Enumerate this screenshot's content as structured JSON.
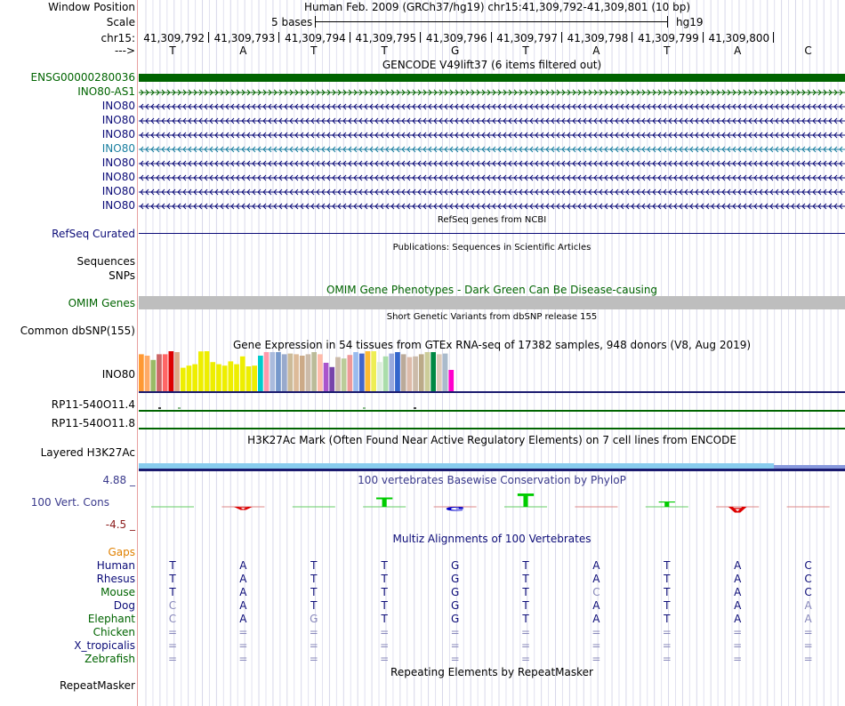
{
  "header": {
    "window_position_label": "Window Position",
    "window_position_text": "Human Feb. 2009 (GRCh37/hg19)   chr15:41,309,792-41,309,801 (10 bp)",
    "scale_label": "Scale",
    "scale_text": "5 bases",
    "assembly": "hg19",
    "chrom_label": "chr15:",
    "strand_label": "--->",
    "positions": [
      "41,309,792",
      "41,309,793",
      "41,309,794",
      "41,309,795",
      "41,309,796",
      "41,309,797",
      "41,309,798",
      "41,309,799",
      "41,309,800"
    ],
    "sequence": [
      "T",
      "A",
      "T",
      "T",
      "G",
      "T",
      "A",
      "T",
      "A",
      "C"
    ]
  },
  "gencode": {
    "title": "GENCODE V49lift37 (6 items filtered out)",
    "rows": [
      {
        "label": "ENSG00000280036",
        "color": "#006400",
        "type": "bar"
      },
      {
        "label": "INO80-AS1",
        "color": "#006400",
        "type": "plus"
      },
      {
        "label": "INO80",
        "color": "#0c0c78",
        "type": "minus"
      },
      {
        "label": "INO80",
        "color": "#0c0c78",
        "type": "minus"
      },
      {
        "label": "INO80",
        "color": "#0c0c78",
        "type": "minus"
      },
      {
        "label": "INO80",
        "color": "#1a7fa0",
        "type": "minus"
      },
      {
        "label": "INO80",
        "color": "#0c0c78",
        "type": "minus"
      },
      {
        "label": "INO80",
        "color": "#0c0c78",
        "type": "minus"
      },
      {
        "label": "INO80",
        "color": "#0c0c78",
        "type": "minus"
      },
      {
        "label": "INO80",
        "color": "#0c0c78",
        "type": "minus"
      }
    ]
  },
  "refseq": {
    "title": "RefSeq genes from NCBI",
    "label": "RefSeq Curated"
  },
  "publications": {
    "title": "Publications: Sequences in Scientific Articles",
    "label1": "Sequences",
    "label2": "SNPs"
  },
  "omim": {
    "title": "OMIM Gene Phenotypes - Dark Green Can Be Disease-causing",
    "label": "OMIM Genes"
  },
  "dbsnp": {
    "title": "Short Genetic Variants from dbSNP release 155",
    "label": "Common dbSNP(155)"
  },
  "gtex": {
    "title": "Gene Expression in 54 tissues from GTEx RNA-seq of 17382 samples, 948 donors (V8, Aug 2019)",
    "label": "INO80",
    "bars": [
      {
        "v": 0.52,
        "c": "#ff9933"
      },
      {
        "v": 0.5,
        "c": "#ffaa66"
      },
      {
        "v": 0.44,
        "c": "#99bb66"
      },
      {
        "v": 0.52,
        "c": "#cc6666"
      },
      {
        "v": 0.52,
        "c": "#ff6666"
      },
      {
        "v": 0.58,
        "c": "#dd0000"
      },
      {
        "v": 0.55,
        "c": "#ddaa88"
      },
      {
        "v": 0.33,
        "c": "#eeee00"
      },
      {
        "v": 0.36,
        "c": "#eeee00"
      },
      {
        "v": 0.38,
        "c": "#eeee00"
      },
      {
        "v": 0.56,
        "c": "#eeee00"
      },
      {
        "v": 0.6,
        "c": "#eeee00"
      },
      {
        "v": 0.41,
        "c": "#eeee00"
      },
      {
        "v": 0.38,
        "c": "#eeee00"
      },
      {
        "v": 0.36,
        "c": "#eeee00"
      },
      {
        "v": 0.42,
        "c": "#eeee00"
      },
      {
        "v": 0.38,
        "c": "#eeee00"
      },
      {
        "v": 0.49,
        "c": "#eeee00"
      },
      {
        "v": 0.35,
        "c": "#eeee00"
      },
      {
        "v": 0.36,
        "c": "#eeee00"
      },
      {
        "v": 0.5,
        "c": "#00cccc"
      },
      {
        "v": 0.55,
        "c": "#ff99aa"
      },
      {
        "v": 0.55,
        "c": "#aabbdd"
      },
      {
        "v": 0.55,
        "c": "#7799cc"
      },
      {
        "v": 0.52,
        "c": "#99aacc"
      },
      {
        "v": 0.53,
        "c": "#ccbb99"
      },
      {
        "v": 0.52,
        "c": "#ddbb99"
      },
      {
        "v": 0.5,
        "c": "#ccaa88"
      },
      {
        "v": 0.52,
        "c": "#ccbbaa"
      },
      {
        "v": 0.55,
        "c": "#bbbb99"
      },
      {
        "v": 0.52,
        "c": "#ffbbaa"
      },
      {
        "v": 0.4,
        "c": "#aa55cc"
      },
      {
        "v": 0.34,
        "c": "#7744aa"
      },
      {
        "v": 0.48,
        "c": "#ccbbaa"
      },
      {
        "v": 0.46,
        "c": "#bbcc99"
      },
      {
        "v": 0.51,
        "c": "#ee9999"
      },
      {
        "v": 0.55,
        "c": "#99bbee"
      },
      {
        "v": 0.53,
        "c": "#4466cc"
      },
      {
        "v": 0.61,
        "c": "#ffbb33"
      },
      {
        "v": 0.57,
        "c": "#eeee55"
      },
      {
        "v": 0.41,
        "c": "#ddeedd"
      },
      {
        "v": 0.49,
        "c": "#aaddaa"
      },
      {
        "v": 0.53,
        "c": "#99aadd"
      },
      {
        "v": 0.55,
        "c": "#3366cc"
      },
      {
        "v": 0.52,
        "c": "#bbaa99"
      },
      {
        "v": 0.48,
        "c": "#ddbbaa"
      },
      {
        "v": 0.49,
        "c": "#ccbbaa"
      },
      {
        "v": 0.52,
        "c": "#bbaa88"
      },
      {
        "v": 0.55,
        "c": "#cccc99"
      },
      {
        "v": 0.55,
        "c": "#008844"
      },
      {
        "v": 0.52,
        "c": "#ddccbb"
      },
      {
        "v": 0.53,
        "c": "#aabbcc"
      },
      {
        "v": 0.3,
        "c": "#ff00cc"
      }
    ]
  },
  "rp11": {
    "label1": "RP11-540O11.4",
    "label2": "RP11-540O11.8"
  },
  "h3k27": {
    "title": "H3K27Ac Mark (Often Found Near Active Regulatory Elements) on 7 cell lines from ENCODE",
    "label": "Layered H3K27Ac"
  },
  "phylop": {
    "title": "100 vertebrates Basewise Conservation by PhyloP",
    "max": "4.88 _",
    "label": "100 Vert. Cons",
    "min": "-4.5 _",
    "scores": [
      0.1,
      -0.6,
      0,
      1.8,
      -0.8,
      2.6,
      -0.1,
      1.0,
      -1.1,
      -0.1
    ],
    "letters": [
      "T",
      "A",
      "T",
      "T",
      "G",
      "T",
      "A",
      "T",
      "A",
      "C"
    ]
  },
  "multiz": {
    "title": "Multiz Alignments of 100 Vertebrates",
    "gaps_label": "Gaps",
    "species": [
      {
        "name": "Human",
        "color": "#0c0c78",
        "bases": [
          "T",
          "A",
          "T",
          "T",
          "G",
          "T",
          "A",
          "T",
          "A",
          "C"
        ],
        "dim": []
      },
      {
        "name": "Rhesus",
        "color": "#0c0c78",
        "bases": [
          "T",
          "A",
          "T",
          "T",
          "G",
          "T",
          "A",
          "T",
          "A",
          "C"
        ],
        "dim": []
      },
      {
        "name": "Mouse",
        "color": "#006400",
        "bases": [
          "T",
          "A",
          "T",
          "T",
          "G",
          "T",
          "C",
          "T",
          "A",
          "C"
        ],
        "dim": [
          6
        ]
      },
      {
        "name": "Dog",
        "color": "#0c0c78",
        "bases": [
          "C",
          "A",
          "T",
          "T",
          "G",
          "T",
          "A",
          "T",
          "A",
          "A"
        ],
        "dim": [
          0,
          9
        ]
      },
      {
        "name": "Elephant",
        "color": "#006400",
        "bases": [
          "C",
          "A",
          "G",
          "T",
          "G",
          "T",
          "A",
          "T",
          "A",
          "A"
        ],
        "dim": [
          0,
          2,
          9
        ]
      },
      {
        "name": "Chicken",
        "color": "#006400",
        "bases": [
          "=",
          "=",
          "=",
          "=",
          "=",
          "=",
          "=",
          "=",
          "=",
          "="
        ],
        "dim": [
          0,
          1,
          2,
          3,
          4,
          5,
          6,
          7,
          8,
          9
        ]
      },
      {
        "name": "X_tropicalis",
        "color": "#0c0c78",
        "bases": [
          "=",
          "=",
          "=",
          "=",
          "=",
          "=",
          "=",
          "=",
          "=",
          "="
        ],
        "dim": [
          0,
          1,
          2,
          3,
          4,
          5,
          6,
          7,
          8,
          9
        ]
      },
      {
        "name": "Zebrafish",
        "color": "#006400",
        "bases": [
          "=",
          "=",
          "=",
          "=",
          "=",
          "=",
          "=",
          "=",
          "=",
          "="
        ],
        "dim": [
          0,
          1,
          2,
          3,
          4,
          5,
          6,
          7,
          8,
          9
        ]
      }
    ]
  },
  "repeatmasker": {
    "title": "Repeating Elements by RepeatMasker",
    "label": "RepeatMasker"
  }
}
